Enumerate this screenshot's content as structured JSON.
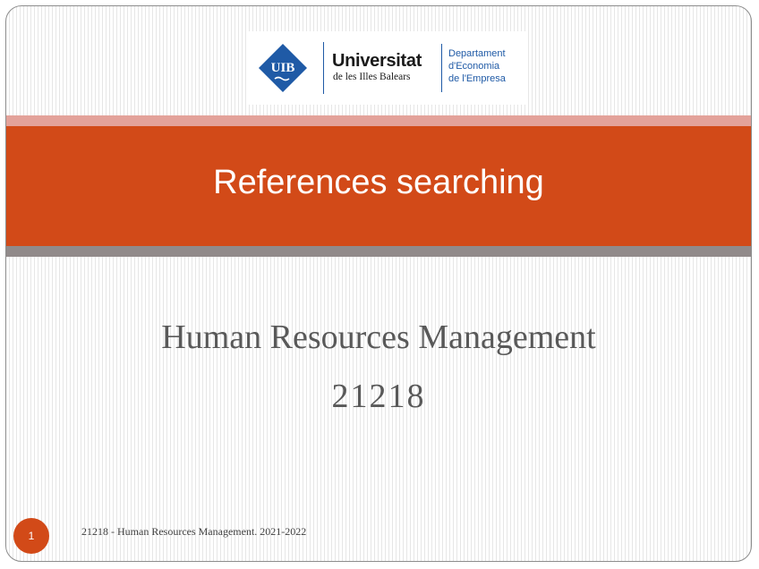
{
  "logo": {
    "badge_text": "UIB",
    "university_name": "Universitat",
    "university_sub": "de les Illes Balears",
    "department_lines": [
      "Departament",
      "d'Economia",
      "de l'Empresa"
    ]
  },
  "slide": {
    "title": "References searching",
    "subtitle_line1": "Human Resources Management",
    "subtitle_line2": "21218",
    "page_number": "1",
    "footer": "21218 - Human Resources Management. 2021-2022"
  },
  "colors": {
    "accent": "#d24a18",
    "band_top": "#e3a29a",
    "band_bottom": "#918a8a",
    "logo_blue": "#1f5aa6"
  }
}
